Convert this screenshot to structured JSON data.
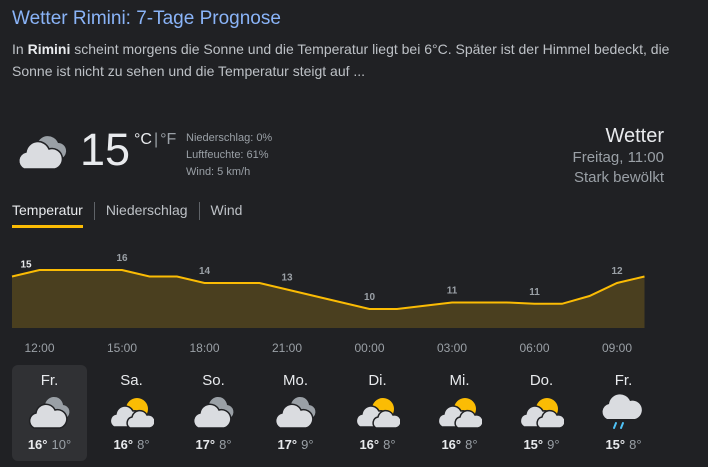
{
  "result": {
    "title": "Wetter Rimini: 7-Tage Prognose",
    "snippet_before": "In ",
    "snippet_bold": "Rimini",
    "snippet_after": " scheint morgens die Sonne und die Temperatur liegt bei 6°C. Später ist der Himmel bedeckt, die Sonne ist nicht zu sehen und die Temperatur steigt auf ..."
  },
  "current": {
    "temp": "15",
    "unit_c": "°C",
    "unit_sep": "|",
    "unit_f": "°F",
    "icon": "cloudy-icon",
    "precip": "Niederschlag: 0%",
    "humidity": "Luftfeuchte: 61%",
    "wind": "Wind: 5 km/h"
  },
  "summary": {
    "title": "Wetter",
    "time": "Freitag, 11:00",
    "condition": "Stark bewölkt"
  },
  "tabs": [
    "Temperatur",
    "Niederschlag",
    "Wind"
  ],
  "colors": {
    "accent": "#fbbc04",
    "area_fill": "#4a3f1f",
    "link": "#8ab4f8",
    "background": "#202124"
  },
  "chart_data": {
    "type": "area",
    "x": [
      "11:00",
      "12:00",
      "13:00",
      "14:00",
      "15:00",
      "16:00",
      "17:00",
      "18:00",
      "19:00",
      "20:00",
      "21:00",
      "22:00",
      "23:00",
      "00:00",
      "01:00",
      "02:00",
      "03:00",
      "04:00",
      "05:00",
      "06:00",
      "07:00",
      "08:00",
      "09:00",
      "10:00"
    ],
    "values": [
      15,
      16,
      16,
      16,
      16,
      15,
      15,
      14,
      14,
      14,
      13,
      12,
      11,
      10,
      10,
      10.5,
      11,
      11,
      11,
      10.8,
      10.8,
      12,
      14,
      15
    ],
    "labels": [
      {
        "index": 0,
        "text": "15"
      },
      {
        "index": 4,
        "text": "16"
      },
      {
        "index": 7,
        "text": "14"
      },
      {
        "index": 10,
        "text": "13"
      },
      {
        "index": 13,
        "text": "10"
      },
      {
        "index": 16,
        "text": "11"
      },
      {
        "index": 19,
        "text": "11"
      },
      {
        "index": 22,
        "text": "12"
      }
    ],
    "tick_labels": [
      "12:00",
      "15:00",
      "18:00",
      "21:00",
      "00:00",
      "03:00",
      "06:00",
      "09:00"
    ],
    "ylim": [
      5,
      18
    ],
    "grid": false,
    "legend": "none"
  },
  "days": [
    {
      "name": "Fr.",
      "icon": "cloudy-icon",
      "hi": "16°",
      "lo": "10°"
    },
    {
      "name": "Sa.",
      "icon": "partly-cloudy-icon",
      "hi": "16°",
      "lo": "8°"
    },
    {
      "name": "So.",
      "icon": "cloudy-icon",
      "hi": "17°",
      "lo": "8°"
    },
    {
      "name": "Mo.",
      "icon": "cloudy-icon",
      "hi": "17°",
      "lo": "9°"
    },
    {
      "name": "Di.",
      "icon": "partly-cloudy-icon",
      "hi": "16°",
      "lo": "8°"
    },
    {
      "name": "Mi.",
      "icon": "partly-cloudy-icon",
      "hi": "16°",
      "lo": "8°"
    },
    {
      "name": "Do.",
      "icon": "partly-cloudy-icon",
      "hi": "15°",
      "lo": "9°"
    },
    {
      "name": "Fr.",
      "icon": "rain-icon",
      "hi": "15°",
      "lo": "8°"
    }
  ]
}
